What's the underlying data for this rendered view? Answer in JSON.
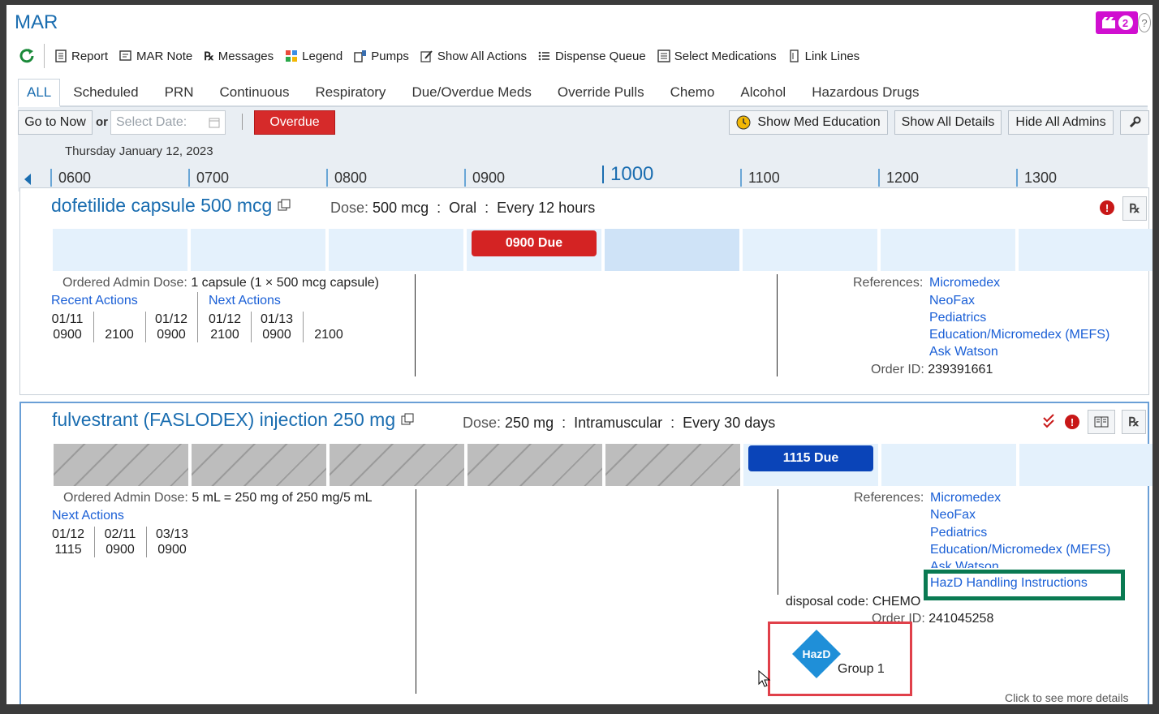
{
  "app": {
    "title": "MAR",
    "badge_count": "2",
    "help": "?"
  },
  "toolbar": {
    "report": "Report",
    "mar_note": "MAR Note",
    "messages": "Messages",
    "legend": "Legend",
    "pumps": "Pumps",
    "show_all_actions": "Show All Actions",
    "dispense_queue": "Dispense Queue",
    "select_medications": "Select Medications",
    "link_lines": "Link Lines"
  },
  "tabs": [
    "ALL",
    "Scheduled",
    "PRN",
    "Continuous",
    "Respiratory",
    "Due/Overdue Meds",
    "Override Pulls",
    "Chemo",
    "Alcohol",
    "Hazardous Drugs"
  ],
  "controls": {
    "go_to_now": "Go to Now",
    "or": "or",
    "date_placeholder": "Select Date:",
    "overdue": "Overdue",
    "show_med_education": "Show Med Education",
    "show_all_details": "Show All Details",
    "hide_all_admins": "Hide All Admins"
  },
  "date_label": "Thursday January 12, 2023",
  "timeline": [
    "0600",
    "0700",
    "0800",
    "0900",
    "1000",
    "1100",
    "1200",
    "1300"
  ],
  "med1": {
    "name": "dofetilide capsule 500 mcg",
    "dose_label": "Dose:",
    "dose": "500 mcg",
    "route": "Oral",
    "frequency": "Every 12 hours",
    "due": "0900 Due",
    "ordered_label": "Ordered Admin Dose:",
    "ordered_value": "1 capsule (1 × 500 mcg capsule)",
    "recent_actions": "Recent Actions",
    "next_actions": "Next Actions",
    "recent": [
      [
        "01/11",
        "0900"
      ],
      [
        "",
        "2100"
      ],
      [
        "01/12",
        "0900"
      ]
    ],
    "next": [
      [
        "01/12",
        "2100"
      ],
      [
        "01/13",
        "0900"
      ],
      [
        "",
        "2100"
      ]
    ],
    "references_label": "References:",
    "references": [
      "Micromedex",
      "NeoFax",
      "Pediatrics",
      "Education/Micromedex (MEFS)",
      "Ask Watson"
    ],
    "order_id_label": "Order ID:",
    "order_id": "239391661"
  },
  "med2": {
    "name": "fulvestrant (FASLODEX) injection 250 mg",
    "dose_label": "Dose:",
    "dose": "250 mg",
    "route": "Intramuscular",
    "frequency": "Every 30 days",
    "due": "1115 Due",
    "ordered_label": "Ordered Admin Dose:",
    "ordered_value": "5 mL = 250 mg of 250 mg/5 mL",
    "next_actions": "Next Actions",
    "next": [
      [
        "01/12",
        "1115"
      ],
      [
        "02/11",
        "0900"
      ],
      [
        "03/13",
        "0900"
      ]
    ],
    "references_label": "References:",
    "references": [
      "Micromedex",
      "NeoFax",
      "Pediatrics",
      "Education/Micromedex (MEFS)",
      "Ask Watson",
      "HazD Handling Instructions"
    ],
    "disposal_label": "disposal code:",
    "disposal": "CHEMO",
    "order_id_label": "Order ID:",
    "order_id": "241045258",
    "hazd_icon": "HazD",
    "hazd_group": "Group 1"
  },
  "footer_hint": "Click to see more details",
  "colors": {
    "accent": "#1a6db0",
    "overdue": "#d42323",
    "due_blue": "#0a44b8",
    "highlight_green": "#0a7a52",
    "highlight_red": "#e0404a"
  }
}
